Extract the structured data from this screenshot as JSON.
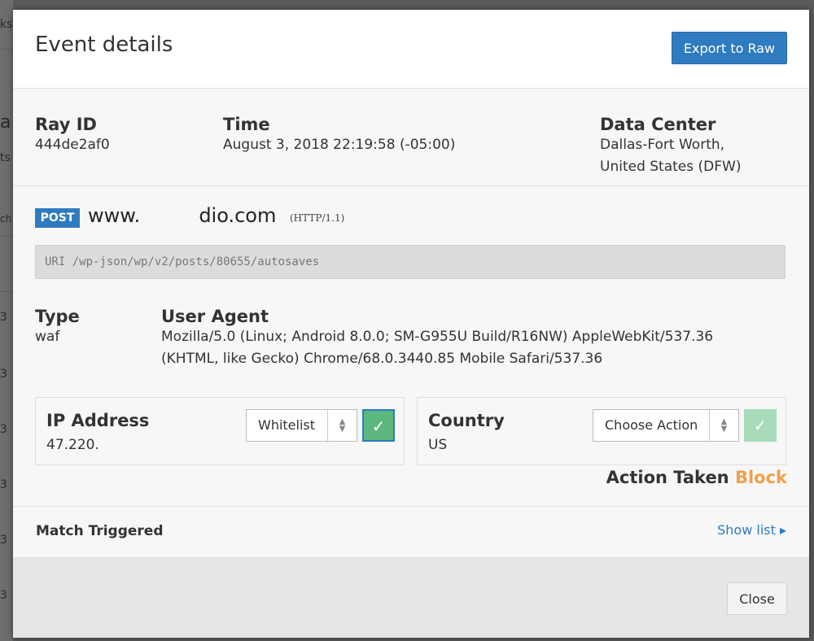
{
  "backdrop": {
    "fragments": [
      "ks",
      "a",
      "ts",
      "ch",
      "3",
      "3",
      "3",
      "3",
      "3",
      "3",
      "3"
    ]
  },
  "modal": {
    "title": "Event details",
    "export_button": "Export to Raw",
    "ray_id": {
      "label": "Ray ID",
      "value": "444de2af0"
    },
    "time": {
      "label": "Time",
      "value": "August 3, 2018 22:19:58 (-05:00)"
    },
    "data_center": {
      "label": "Data Center",
      "value_line1": "Dallas-Fort Worth,",
      "value_line2": "United States (DFW)"
    },
    "request": {
      "method": "POST",
      "host_prefix": "www.",
      "host_suffix": "dio.com",
      "protocol": "(HTTP/1.1)",
      "uri": "URI /wp-json/wp/v2/posts/80655/autosaves"
    },
    "type": {
      "label": "Type",
      "value": "waf"
    },
    "user_agent": {
      "label": "User Agent",
      "line1": "Mozilla/5.0 (Linux; Android 8.0.0; SM-G955U Build/R16NW) AppleWebKit/537.36",
      "line2": "(KHTML, like Gecko) Chrome/68.0.3440.85 Mobile Safari/537.36"
    },
    "ip": {
      "label": "IP Address",
      "value": "47.220.",
      "select_value": "Whitelist"
    },
    "country": {
      "label": "Country",
      "value": "US",
      "select_value": "Choose Action"
    },
    "action_taken": {
      "label": "Action Taken",
      "value": "Block"
    },
    "match": {
      "label": "Match Triggered",
      "show_list": "Show list ▸"
    },
    "close_button": "Close"
  },
  "colors": {
    "accent": "#2f7bbf",
    "block": "#f0a04b",
    "confirm_active": "#5cb87e",
    "confirm_disabled": "#a8dcbb"
  },
  "icons": {
    "confirm": "check-icon",
    "select_arrows": "updown-chevron-icon",
    "show_list": "triangle-right-icon"
  }
}
